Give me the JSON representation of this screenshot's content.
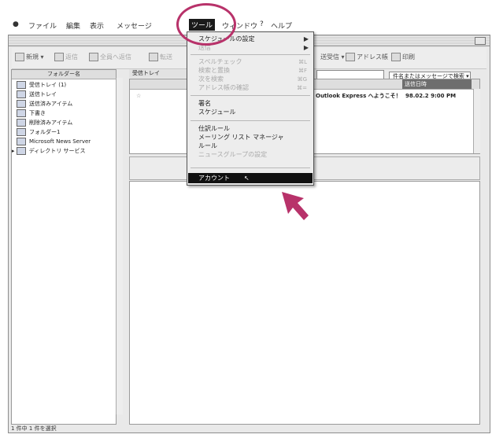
{
  "menubar": {
    "items": [
      "ファイル",
      "編集",
      "表示",
      "メッセージ",
      "ツール",
      "ウィンドウ",
      "ヘルプ"
    ]
  },
  "toolbar": {
    "new_label": "新規",
    "reply_label": "返信",
    "reply_all_label": "全員へ返信",
    "forward_label": "転送",
    "send_receive_label": "送受信",
    "address_book_label": "アドレス帳",
    "print_label": "印刷"
  },
  "filter": {
    "selected": "件名またはメッセージで検索"
  },
  "folders": {
    "header": "フォルダー名",
    "items": [
      "受信トレイ (1)",
      "送信トレイ",
      "送信済みアイテム",
      "下書き",
      "削除済みアイテム",
      "フォルダー1",
      "Microsoft News Server",
      "ディレクトリ サービス"
    ]
  },
  "list": {
    "folder_title": "受信トレイ",
    "column_date": "送信日時",
    "message_subject": "Outlook Express へようこそ！",
    "message_date": "98.02.2 9:00 PM"
  },
  "tools_menu": {
    "items": [
      {
        "label": "スケジュールの設定",
        "disabled": false,
        "submenu": true,
        "shortcut": ""
      },
      {
        "label": "送信",
        "disabled": true,
        "submenu": true,
        "shortcut": ""
      },
      {
        "label": "スペルチェック",
        "disabled": true,
        "submenu": false,
        "shortcut": "⌘L"
      },
      {
        "label": "検索と置換",
        "disabled": true,
        "submenu": false,
        "shortcut": "⌘F"
      },
      {
        "label": "次を検索",
        "disabled": true,
        "submenu": false,
        "shortcut": "⌘G"
      },
      {
        "label": "アドレス帳の確認",
        "disabled": true,
        "submenu": false,
        "shortcut": "⌘="
      },
      {
        "label": "署名",
        "disabled": false,
        "submenu": false,
        "shortcut": ""
      },
      {
        "label": "スケジュール",
        "disabled": false,
        "submenu": false,
        "shortcut": ""
      },
      {
        "label": "仕訳ルール",
        "disabled": false,
        "submenu": false,
        "shortcut": ""
      },
      {
        "label": "メーリング リスト マネージャ",
        "disabled": false,
        "submenu": false,
        "shortcut": ""
      },
      {
        "label": "ルール",
        "disabled": false,
        "submenu": false,
        "shortcut": ""
      },
      {
        "label": "ニュースグループの設定",
        "disabled": true,
        "submenu": false,
        "shortcut": ""
      }
    ],
    "selected_item": "アカウント"
  },
  "status": {
    "text": "1 件中 1 件を選択"
  },
  "colors": {
    "highlight": "#b8326a",
    "menu_selected": "#111111"
  }
}
